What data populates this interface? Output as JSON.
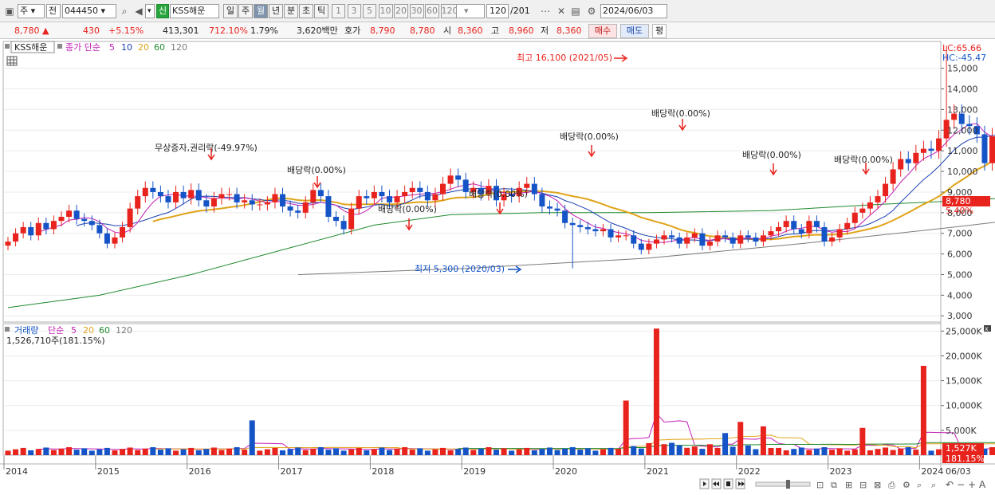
{
  "toolbar": {
    "market_type": "주",
    "market_sub": "전",
    "code": "044450",
    "badge": "신",
    "name": "KSS해운",
    "periods": [
      "일",
      "주",
      "월",
      "년",
      "분",
      "초",
      "틱"
    ],
    "period_selected": "월",
    "intervals": [
      "1",
      "3",
      "5",
      "10",
      "20",
      "30",
      "60",
      "120"
    ],
    "count": "120",
    "total": "/201",
    "date": "2024/06/03"
  },
  "quote": {
    "price": "8,780",
    "arrow": "▲",
    "change": "430",
    "rate": "+5.15%",
    "volume": "413,301",
    "vol_ratio": "712.10%",
    "turnover": "1.79%",
    "amount": "3,620백만",
    "hoga_label": "호가",
    "ask": "8,790",
    "bid": "8,780",
    "open_label": "시",
    "open": "8,360",
    "high_label": "고",
    "high": "8,960",
    "low_label": "저",
    "low": "8,360",
    "buy": "매수",
    "sell": "매도",
    "eval": "평"
  },
  "price_panel": {
    "stock": "KSS해운",
    "ma_title": "종가 단순",
    "ma_periods": [
      "5",
      "10",
      "20",
      "60",
      "120"
    ],
    "lc": "LC:65.66",
    "hc": "HC:-45.47",
    "y_labels": [
      "15,000",
      "14,000",
      "13,000",
      "12,000",
      "11,000",
      "10,000",
      "9,000",
      "8,000",
      "7,000",
      "6,000",
      "5,000",
      "4,000",
      "3,000"
    ],
    "current_tag": "8,780",
    "pct_tag": "5.40%",
    "high_note": "최고 16,100 (2021/05)",
    "low_note": "최저 5,300 (2020/03)",
    "events": [
      "무상증자,권리락(-49.97%)",
      "배당락(0.00%)",
      "배당락(0.00%)",
      "배당락(0.00%)",
      "배당락(0.00%)",
      "배당락(0.00%)",
      "배당락(0.00%)",
      "배당락(0.00%)"
    ]
  },
  "volume_panel": {
    "title": "거래량",
    "ma_title": "단순",
    "ma_periods": [
      "5",
      "20",
      "60",
      "120"
    ],
    "readout": "1,526,710주(181.15%)",
    "y_labels": [
      "25,000K",
      "20,000K",
      "15,000K",
      "10,000K",
      "5,000K"
    ],
    "current_tag": "1,527K",
    "pct_tag": "181.15%"
  },
  "xaxis": {
    "years": [
      "2014",
      "2015",
      "2016",
      "2017",
      "2018",
      "2019",
      "2020",
      "2021",
      "2022",
      "2023",
      "2024"
    ],
    "last": "06/03"
  },
  "colors": {
    "up": "#e8231d",
    "down": "#1554c7",
    "ma5": "#c21fb4",
    "ma10": "#1a3fb0",
    "ma20": "#e0a419",
    "ma60": "#1f8a2e",
    "ma120": "#7a7a7a"
  },
  "chart_data": {
    "type": "candlestick",
    "start": "2014-01",
    "unit": "month",
    "closes": [
      6600,
      7000,
      7300,
      6900,
      7500,
      7200,
      7600,
      7800,
      8100,
      7700,
      7600,
      7400,
      7000,
      6500,
      6800,
      7300,
      8200,
      8800,
      9200,
      9000,
      8800,
      8500,
      9000,
      8700,
      9100,
      8600,
      8300,
      8700,
      8900,
      8900,
      8500,
      8600,
      8400,
      8400,
      8500,
      8900,
      8300,
      8100,
      8000,
      8500,
      9100,
      8800,
      7800,
      7600,
      7200,
      8200,
      8800,
      8700,
      9000,
      8800,
      8500,
      8800,
      9000,
      9200,
      9000,
      8600,
      8900,
      9400,
      9800,
      9600,
      9000,
      9200,
      8900,
      9300,
      8600,
      8900,
      8800,
      9200,
      9400,
      8900,
      8300,
      8200,
      8100,
      7500,
      7400,
      7300,
      7200,
      7100,
      7200,
      6800,
      6900,
      6900,
      6500,
      6200,
      6500,
      6700,
      6900,
      6800,
      6500,
      6800,
      7000,
      6400,
      6600,
      6900,
      6800,
      6500,
      6900,
      6800,
      6600,
      6900,
      7100,
      7300,
      7600,
      7200,
      7000,
      7600,
      7300,
      6600,
      6800,
      7200,
      7500,
      8000,
      8200,
      8500,
      8800,
      9400,
      10100,
      10600,
      10400,
      10900,
      11100,
      11000,
      11600,
      12500,
      12800,
      12300,
      12200,
      11800,
      10400,
      11700,
      11400,
      11000,
      11700,
      11100,
      11800,
      11300,
      12100,
      11900,
      12300,
      12000,
      11900,
      11300,
      10000,
      10100,
      10600,
      10900,
      10100,
      9000,
      8800,
      9700,
      9300,
      9300,
      9000,
      9200,
      9000,
      8300,
      8800,
      8100,
      8000,
      8100,
      8200,
      9500,
      8000,
      9400,
      8500,
      8200,
      8300,
      8000,
      8500,
      9000,
      8400,
      9300,
      8900,
      8300,
      8600,
      8400,
      8300,
      8780
    ],
    "series": [
      {
        "name": "종가 단순 5"
      },
      {
        "name": "10"
      },
      {
        "name": "20"
      },
      {
        "name": "60"
      },
      {
        "name": "120"
      }
    ],
    "volume_unit": "K",
    "volume_spikes": [
      {
        "date": "2016-09",
        "value": 7000
      },
      {
        "date": "2020-10",
        "value": 11000
      },
      {
        "date": "2021-02",
        "value": 25500
      },
      {
        "date": "2023-05",
        "value": 5500
      },
      {
        "date": "2024-01",
        "value": 18000
      }
    ],
    "price_range": [
      2700,
      16300
    ],
    "volume_range": [
      0,
      26500
    ]
  }
}
